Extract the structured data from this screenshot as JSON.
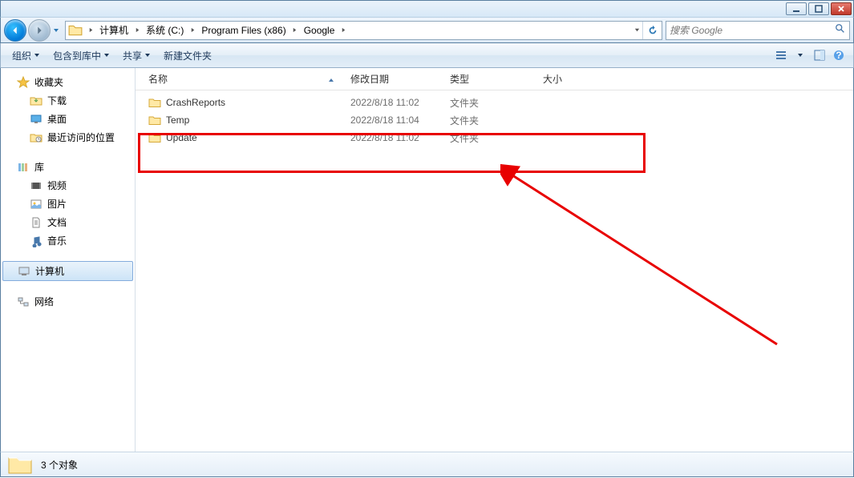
{
  "window_controls": {
    "min": "minimize",
    "max": "maximize",
    "close": "close"
  },
  "breadcrumbs": [
    "计算机",
    "系统 (C:)",
    "Program Files (x86)",
    "Google"
  ],
  "search": {
    "placeholder": "搜索 Google"
  },
  "toolbar": {
    "organize": "组织",
    "include": "包含到库中",
    "share": "共享",
    "newfolder": "新建文件夹"
  },
  "sidebar": {
    "favorites": {
      "label": "收藏夹",
      "items": [
        "下载",
        "桌面",
        "最近访问的位置"
      ]
    },
    "libraries": {
      "label": "库",
      "items": [
        "视频",
        "图片",
        "文档",
        "音乐"
      ]
    },
    "computer": {
      "label": "计算机"
    },
    "network": {
      "label": "网络"
    }
  },
  "columns": {
    "name": "名称",
    "date": "修改日期",
    "type": "类型",
    "size": "大小"
  },
  "rows": [
    {
      "name": "CrashReports",
      "date": "2022/8/18 11:02",
      "type": "文件夹",
      "size": ""
    },
    {
      "name": "Temp",
      "date": "2022/8/18 11:04",
      "type": "文件夹",
      "size": ""
    },
    {
      "name": "Update",
      "date": "2022/8/18 11:02",
      "type": "文件夹",
      "size": ""
    }
  ],
  "status": {
    "text": "3 个对象"
  }
}
